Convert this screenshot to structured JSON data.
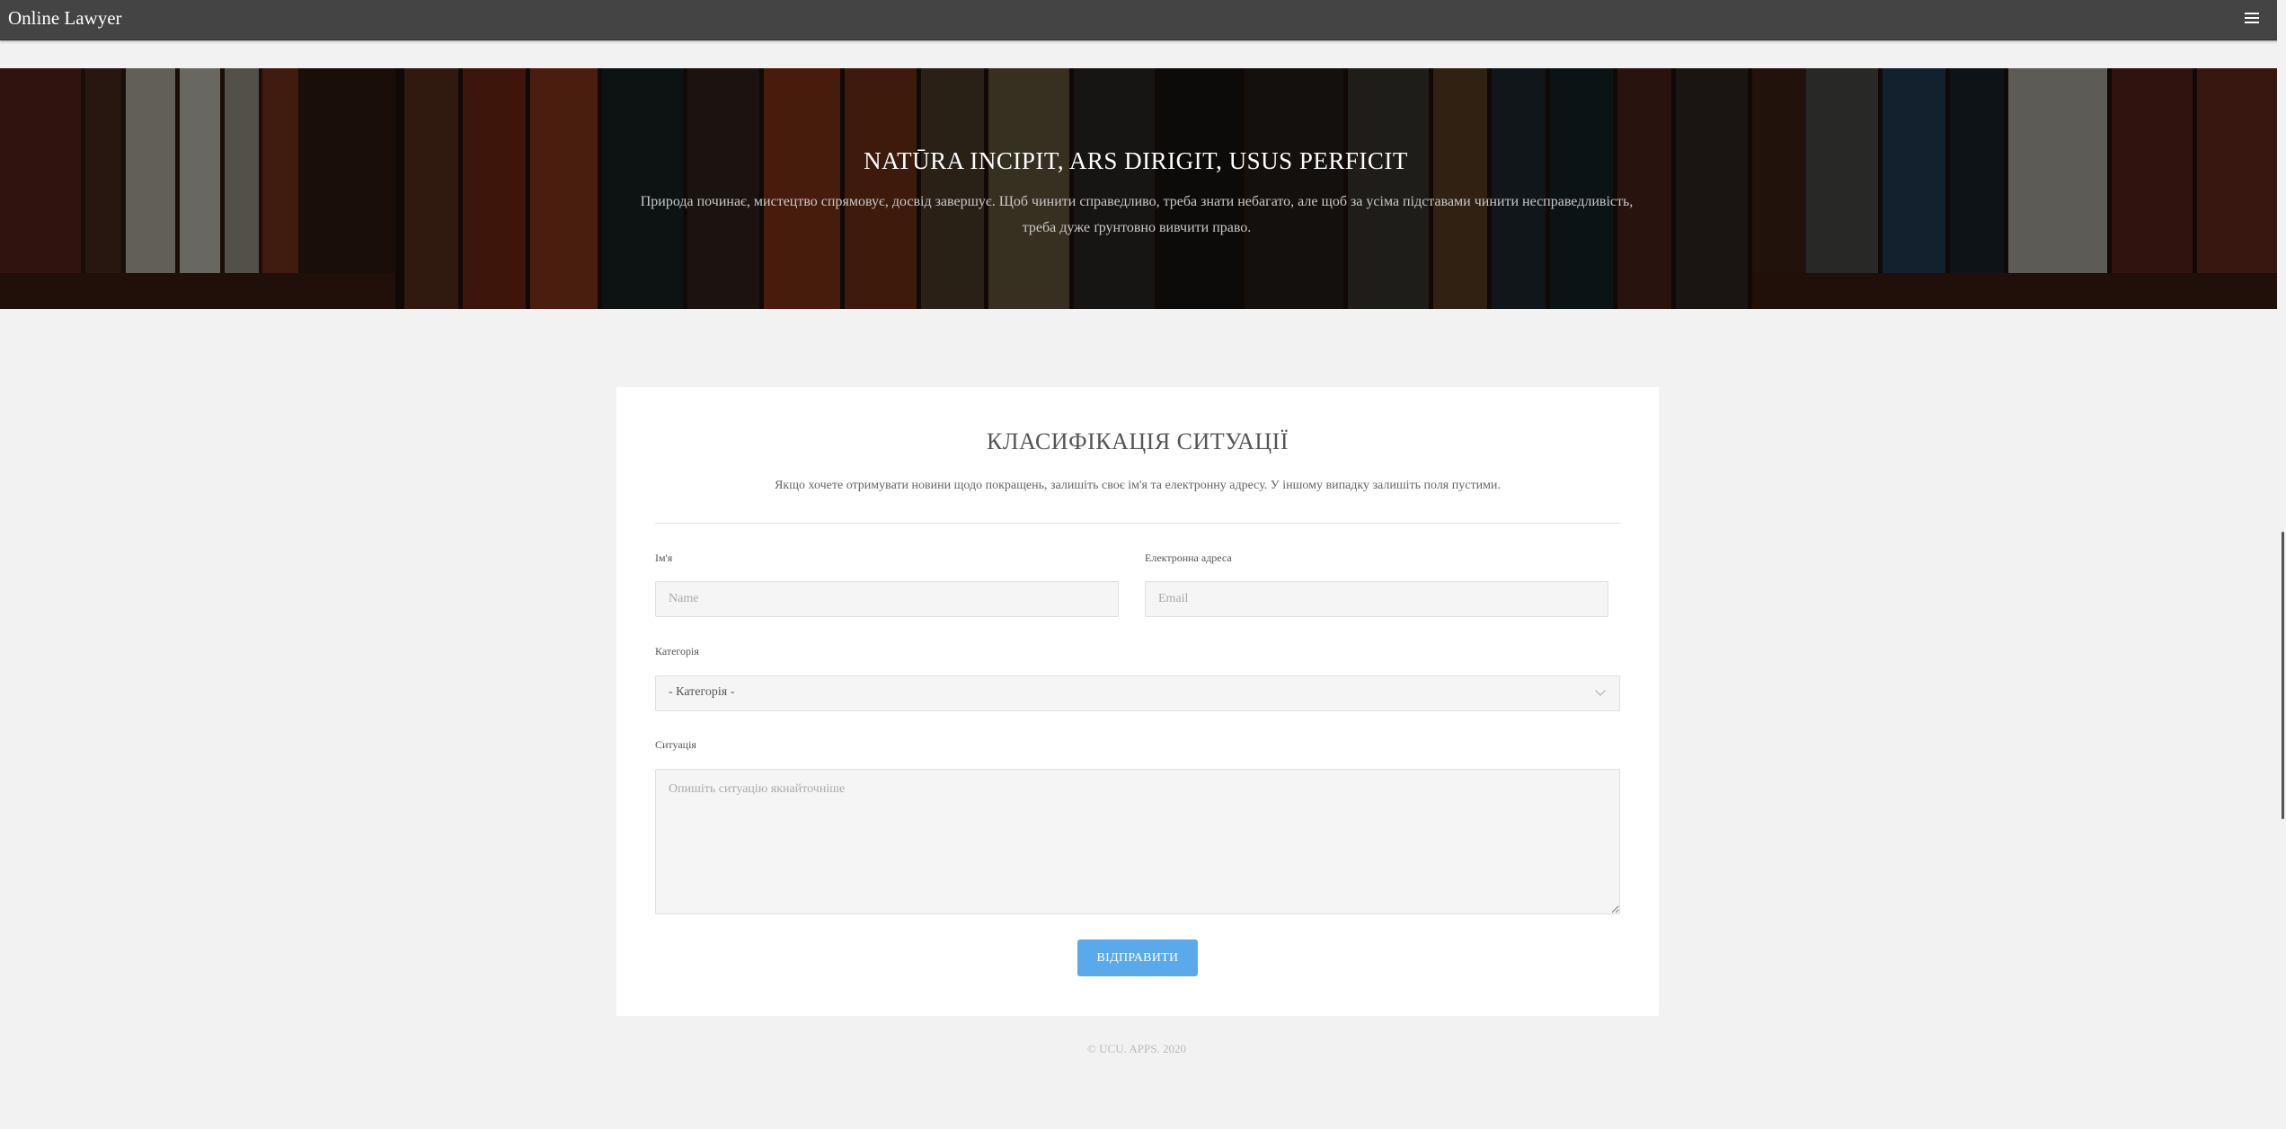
{
  "header": {
    "brand": "Online Lawyer",
    "menu_icon": "hamburger-menu-icon"
  },
  "banner": {
    "title": "NATŪRA INCIPIT, ARS DIRIGIT, USUS PERFICIT",
    "subtitle": "Природа починає, мистецтво спрямовує, досвід завершує. Щоб чинити справедливо, треба знати небагато, але щоб за усіма підставами чинити несправедливість, треба дуже ґрунтовно вивчити право."
  },
  "form": {
    "title": "КЛАСИФІКАЦІЯ СИТУАЦІЇ",
    "description": "Якщо хочете отримувати новини щодо покращень, залишіть своє ім'я та електронну адресу. У іншому випадку залишіть поля пустими.",
    "name_label": "Ім'я",
    "name_placeholder": "Name",
    "email_label": "Електронна адреса",
    "email_placeholder": "Email",
    "category_label": "Категорія",
    "category_selected": "- Категорія -",
    "situation_label": "Ситуація",
    "situation_placeholder": "Опишіть ситуацію якнайточніше",
    "submit_label": "ВІДПРАВИТИ"
  },
  "footer": {
    "copyright": "© UCU. APPS. 2020"
  },
  "colors": {
    "topbar": "#444444",
    "page_background": "#f2f2f2",
    "card_background": "#ffffff",
    "accent_button": "#5aa9ea"
  }
}
